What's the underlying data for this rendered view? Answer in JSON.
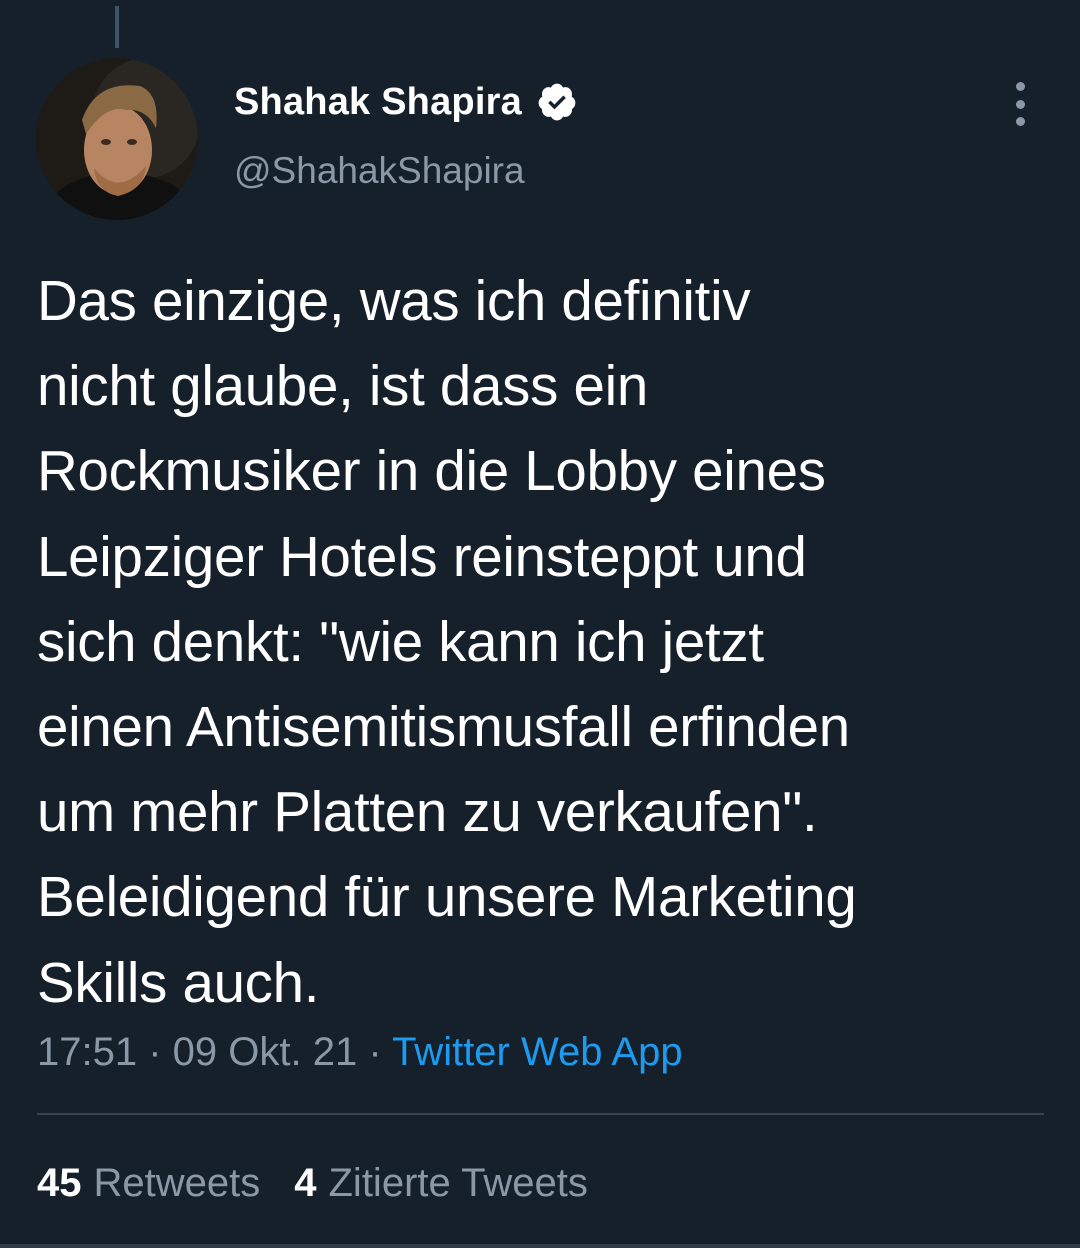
{
  "author": {
    "display_name": "Shahak Shapira",
    "handle": "@ShahakShapira",
    "avatar_icon": "profile-photo",
    "verified_icon": "verified-badge-icon",
    "more_icon": "vertical-ellipsis-icon"
  },
  "tweet": {
    "lines": [
      "Das einzige, was ich definitiv",
      "nicht glaube, ist dass ein",
      "Rockmusiker in die Lobby eines",
      "Leipziger Hotels reinsteppt und",
      "sich denkt: \"wie kann ich jetzt",
      "einen Antisemitismusfall erfinden",
      "um mehr Platten zu verkaufen\".",
      "Beleidigend für unsere Marketing",
      "Skills auch."
    ],
    "time": "17:51",
    "date": "09 Okt. 21",
    "separator": "·",
    "source": "Twitter Web App"
  },
  "stats": {
    "retweets_count": "45",
    "retweets_label": "Retweets",
    "quotes_count": "4",
    "quotes_label": "Zitierte Tweets"
  },
  "colors": {
    "background": "#15202b",
    "secondary_text": "#8b98a5",
    "link": "#1d9bf0",
    "divider": "#38444d"
  }
}
